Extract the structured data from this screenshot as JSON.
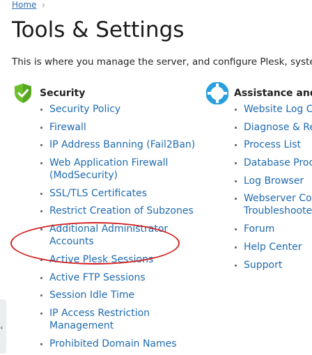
{
  "breadcrumb": {
    "home": "Home",
    "separator": "›"
  },
  "page": {
    "title": "Tools & Settings",
    "intro": "This is where you manage the server, and configure Plesk, system"
  },
  "security": {
    "title": "Security",
    "icon": "shield-check-icon",
    "icon_color": "#6cbf2a",
    "items": [
      [
        "Security Policy"
      ],
      [
        "Firewall"
      ],
      [
        "IP Address Banning (Fail2Ban)"
      ],
      [
        "Web Application Firewall",
        "(ModSecurity)"
      ],
      [
        "SSL/TLS Certificates"
      ],
      [
        "Restrict Creation of Subzones"
      ],
      [
        "Additional Administrator",
        "Accounts"
      ],
      [
        "Active Plesk Sessions"
      ],
      [
        "Active FTP Sessions"
      ],
      [
        "Session Idle Time"
      ],
      [
        "IP Access Restriction",
        "Management"
      ],
      [
        "Prohibited Domain Names"
      ]
    ]
  },
  "assistance": {
    "title": "Assistance and T",
    "icon": "lifebuoy-icon",
    "icon_color": "#2a9fe0",
    "items": [
      [
        "Website Log Ch"
      ],
      [
        "Diagnose & Rep"
      ],
      [
        "Process List"
      ],
      [
        "Database Proce"
      ],
      [
        "Log Browser"
      ],
      [
        "Webserver Con",
        "Troubleshooter"
      ],
      [
        "Forum"
      ],
      [
        "Help Center"
      ],
      [
        "Support"
      ]
    ]
  },
  "annotation": {
    "color": "#d42020"
  },
  "colors": {
    "link": "#1f6ab0",
    "text": "#222222"
  }
}
